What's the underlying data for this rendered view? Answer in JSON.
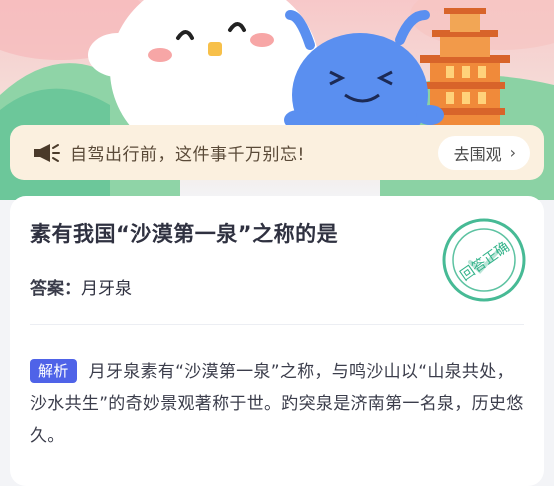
{
  "notice": {
    "text": "自驾出行前，这件事千万别忘!",
    "button_label": "去围观",
    "icon": "megaphone-icon"
  },
  "question": {
    "title": "素有我国“沙漠第一泉”之称的是",
    "answer_label": "答案：",
    "answer_value": "月牙泉",
    "stamp_text": "回答正确"
  },
  "analysis": {
    "tag": "解析",
    "text": "月牙泉素有“沙漠第一泉”之称，与鸣沙山以“山泉共处，沙水共生”的奇妙景观著称于世。趵突泉是济南第一名泉，历史悠久。"
  },
  "colors": {
    "accent": "#4f63e8",
    "stamp": "#33b38a",
    "notice_bg": "#fbf0df"
  }
}
